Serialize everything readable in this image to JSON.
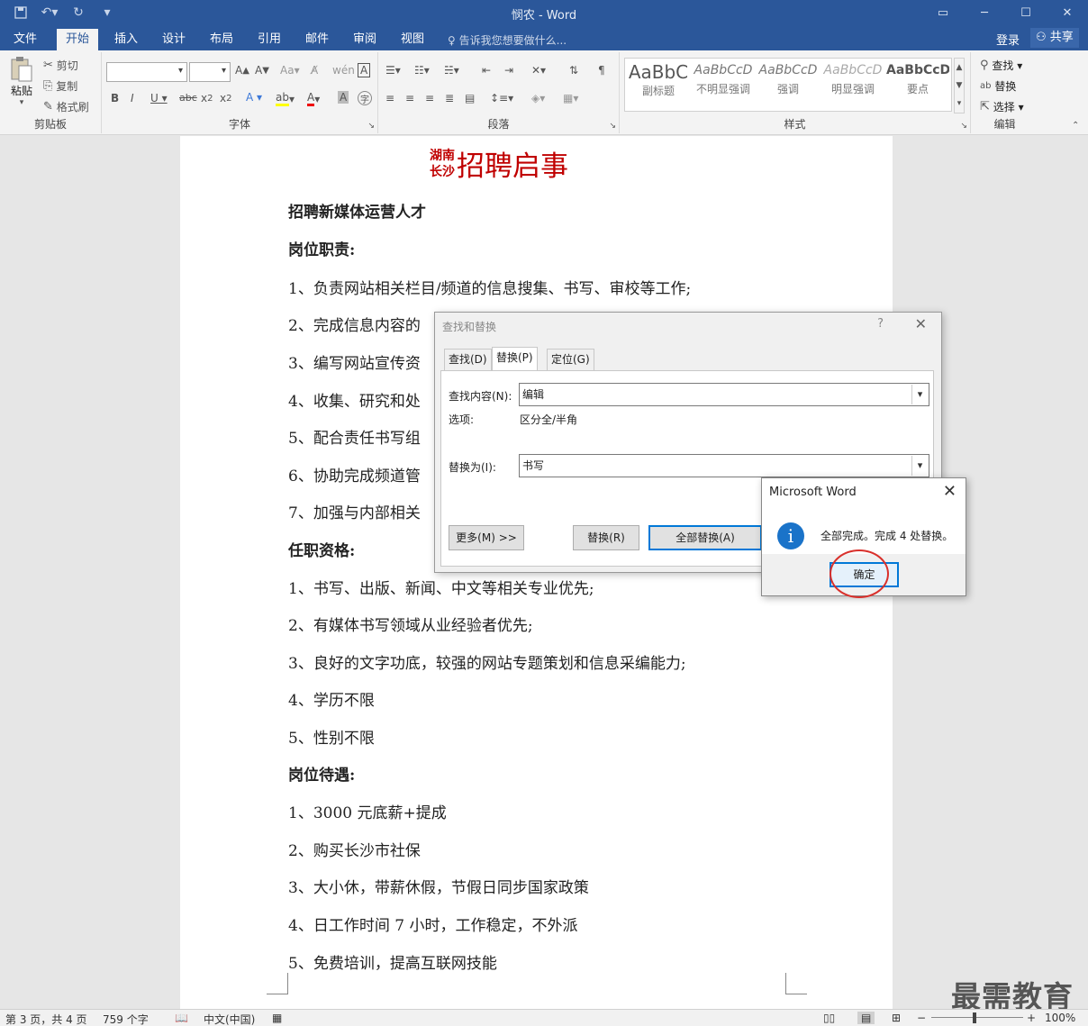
{
  "window": {
    "title": "悯农 - Word",
    "controls": [
      "ribbon-display-icon",
      "minimize-icon",
      "maximize-icon",
      "close-icon"
    ]
  },
  "tabs": [
    {
      "label": "文件",
      "active": false
    },
    {
      "label": "开始",
      "active": true
    },
    {
      "label": "插入",
      "active": false
    },
    {
      "label": "设计",
      "active": false
    },
    {
      "label": "布局",
      "active": false
    },
    {
      "label": "引用",
      "active": false
    },
    {
      "label": "邮件",
      "active": false
    },
    {
      "label": "审阅",
      "active": false
    },
    {
      "label": "视图",
      "active": false
    }
  ],
  "tell_me": "告诉我您想要做什么...",
  "account": {
    "login": "登录",
    "share": "共享"
  },
  "ribbon": {
    "clipboard": {
      "label": "剪贴板",
      "paste": "粘贴",
      "cut": "剪切",
      "copy": "复制",
      "format_painter": "格式刷"
    },
    "font": {
      "label": "字体",
      "font_name": "",
      "font_size": ""
    },
    "paragraph": {
      "label": "段落"
    },
    "styles": {
      "label": "样式",
      "items": [
        {
          "sample": "AaBbC",
          "name": "副标题"
        },
        {
          "sample": "AaBbCcD",
          "name": "不明显强调"
        },
        {
          "sample": "AaBbCcD",
          "name": "强调"
        },
        {
          "sample": "AaBbCcD",
          "name": "明显强调"
        },
        {
          "sample": "AaBbCcD",
          "name": "要点"
        }
      ]
    },
    "editing": {
      "label": "编辑",
      "find": "查找",
      "replace": "替换",
      "select": "选择"
    }
  },
  "document": {
    "title_small_1": "湖南",
    "title_small_2": "长沙",
    "title_big": "招聘启事",
    "lines": [
      {
        "text": "招聘新媒体运营人才",
        "bold": true
      },
      {
        "text": "岗位职责:",
        "bold": true
      },
      {
        "text": "1、负责网站相关栏目/频道的信息搜集、书写、审校等工作;",
        "bold": false
      },
      {
        "text": "2、完成信息内容的",
        "bold": false
      },
      {
        "text": "3、编写网站宣传资",
        "bold": false
      },
      {
        "text": "4、收集、研究和处",
        "bold": false
      },
      {
        "text": "5、配合责任书写组",
        "bold": false
      },
      {
        "text": "6、协助完成频道管",
        "bold": false
      },
      {
        "text": "7、加强与内部相关",
        "bold": false
      },
      {
        "text": "任职资格:",
        "bold": true
      },
      {
        "text": "1、书写、出版、新闻、中文等相关专业优先;",
        "bold": false
      },
      {
        "text": "2、有媒体书写领域从业经验者优先;",
        "bold": false
      },
      {
        "text": "3、良好的文字功底，较强的网站专题策划和信息采编能力;",
        "bold": false
      },
      {
        "text": "4、学历不限",
        "bold": false
      },
      {
        "text": "5、性别不限",
        "bold": false
      },
      {
        "text": "岗位待遇:",
        "bold": true
      },
      {
        "text": "1、3000 元底薪+提成",
        "bold": false
      },
      {
        "text": "2、购买长沙市社保",
        "bold": false
      },
      {
        "text": "3、大小休，带薪休假，节假日同步国家政策",
        "bold": false
      },
      {
        "text": "4、日工作时间 7 小时，工作稳定，不外派",
        "bold": false
      },
      {
        "text": "5、免费培训，提高互联网技能",
        "bold": false
      }
    ]
  },
  "find_replace": {
    "title": "查找和替换",
    "help": "?",
    "tabs": [
      "查找(D)",
      "替换(P)",
      "定位(G)"
    ],
    "selected_tab": 1,
    "find_label": "查找内容(N):",
    "find_value": "编辑",
    "options_label": "选项:",
    "options_value": "区分全/半角",
    "replace_label": "替换为(I):",
    "replace_value": "书写",
    "more_button": "更多(M) >>",
    "replace_button": "替换(R)",
    "replace_all_button": "全部替换(A)"
  },
  "message_box": {
    "title": "Microsoft Word",
    "icon": "info-icon",
    "text": "全部完成。完成 4 处替换。",
    "ok": "确定"
  },
  "status_bar": {
    "page": "第 3 页，共 4 页",
    "words": "759 个字",
    "language": "中文(中国)",
    "zoom": "100%"
  },
  "watermark": "最需教育",
  "colors": {
    "accent": "#2b579a",
    "title_red": "#c00000",
    "annotation": "#d9302b",
    "info_blue": "#1a73c9"
  }
}
